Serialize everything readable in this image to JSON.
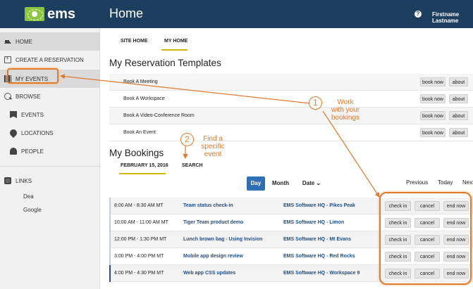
{
  "brand": {
    "name": "ems"
  },
  "header": {
    "title": "Home",
    "help": "?",
    "user_name": "Firstname Lastname",
    "caret": "⌄"
  },
  "sidebar": {
    "items": [
      {
        "label": "HOME",
        "icon": "house-icon"
      },
      {
        "label": "CREATE A RESERVATION",
        "icon": "calendar-plus-icon"
      },
      {
        "label": "MY EVENTS",
        "icon": "grid-icon"
      },
      {
        "label": "BROWSE",
        "icon": "search-icon"
      },
      {
        "label": "EVENTS",
        "icon": "bookmark-icon"
      },
      {
        "label": "LOCATIONS",
        "icon": "location-pin-icon"
      },
      {
        "label": "PEOPLE",
        "icon": "people-icon"
      },
      {
        "label": "LINKS",
        "icon": "link-icon"
      }
    ],
    "links": [
      "Dea",
      "Google"
    ]
  },
  "tabs": [
    {
      "label": "SITE HOME"
    },
    {
      "label": "MY HOME"
    }
  ],
  "templates": {
    "heading": "My Reservation Templates",
    "rows": [
      {
        "name": "Book A Meeting"
      },
      {
        "name": "Book A Workspace"
      },
      {
        "name": "Book A Video-Conference Room"
      },
      {
        "name": "Book An Event"
      }
    ],
    "book_label": "book now",
    "about_label": "about"
  },
  "bookings": {
    "heading": "My Bookings",
    "subtabs": [
      "FEBRUARY 15, 2016",
      "SEARCH"
    ],
    "views": [
      "Day",
      "Month",
      "Date ⌄"
    ],
    "nav": [
      "Previous",
      "Today",
      "Next"
    ],
    "rows": [
      {
        "time": "8:00 AM - 8:30 AM MT",
        "title": "Team status check-in",
        "location": "EMS Software HQ - Pikes Peak",
        "stripe": "#c0cfe0"
      },
      {
        "time": "10:00 AM - 11:00 AM MT",
        "title": "Tiger Team product demo",
        "location": "EMS Software HQ - Limon",
        "stripe": "#c0cfe0"
      },
      {
        "time": "12:00 PM - 1:30 PM MT",
        "title": "Lunch brown bag - Using Invision",
        "location": "EMS Software HQ - Mt Evans",
        "stripe": "#c0cfe0"
      },
      {
        "time": "3:00 PM - 4:00 PM MT",
        "title": "Mobile app design review",
        "location": "EMS Software HQ - Red Rocks",
        "stripe": "#c0cfe0"
      },
      {
        "time": "4:00 PM - 4:30 PM MT",
        "title": "Web app CSS updates",
        "location": "EMS Software HQ - Workspace 9",
        "stripe": "#2a4f7e"
      }
    ],
    "actions": {
      "check_in": "check in",
      "cancel": "cancel",
      "end_now": "end now"
    }
  },
  "annotations": {
    "one_num": "1",
    "one_text_a": "Work",
    "one_text_b": "with your",
    "one_text_c": "bookings",
    "two_num": "2",
    "two_text_a": "Find a",
    "two_text_b": "specific",
    "two_text_c": "event"
  },
  "colors": {
    "header": "#1c3f5f",
    "accent": "#d5b700",
    "annotation": "#e07a2e",
    "primary": "#2f6fb5"
  }
}
